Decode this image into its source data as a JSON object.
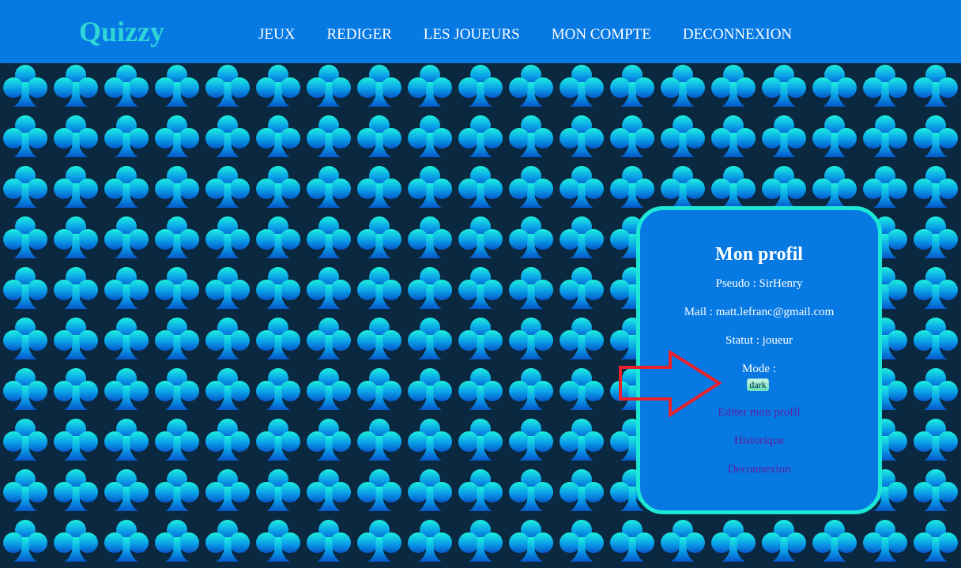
{
  "header": {
    "logo": "Quizzy",
    "nav": [
      "JEUX",
      "REDIGER",
      "LES JOUEURS",
      "MON COMPTE",
      "DECONNEXION"
    ]
  },
  "background": {
    "pattern_icon": "club-suit-icon",
    "tile_colors": [
      "#1cf0de",
      "#0a9fe8",
      "#0557c9"
    ],
    "background_color": "#0a2840"
  },
  "profile": {
    "title": "Mon profil",
    "pseudo": "Pseudo : SirHenry",
    "mail": "Mail : matt.lefranc@gmail.com",
    "statut": "Statut : joueur",
    "mode_label": "Mode :",
    "mode_button": "dark",
    "links": [
      "Editer mon profil",
      "Historique",
      "Deconnexion"
    ]
  },
  "annotation": {
    "icon": "arrow-right-icon",
    "color": "#e8212b"
  },
  "colors": {
    "navbar": "#0679e3",
    "logo": "#2fd6d6",
    "card_border": "#1de8d8",
    "link": "#5b1fa0"
  }
}
